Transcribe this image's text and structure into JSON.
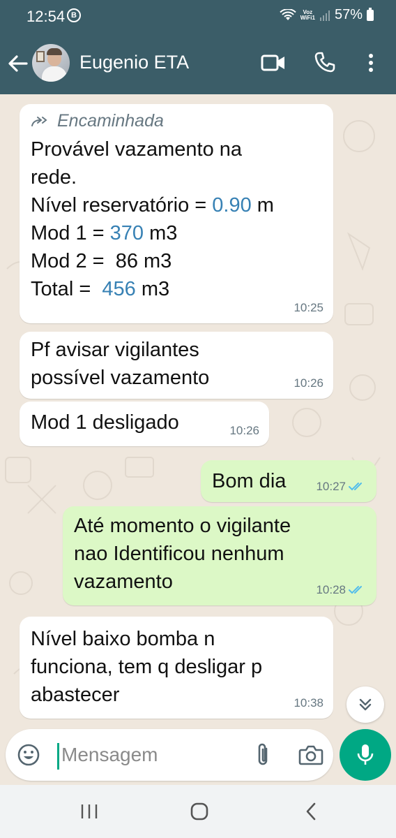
{
  "status": {
    "time": "12:54",
    "notification_badge": "B",
    "network_label_top": "Voz",
    "network_label_bottom": "WiFi1",
    "battery": "57%"
  },
  "header": {
    "contact_name": "Eugenio ETA"
  },
  "messages": [
    {
      "dir": "in",
      "forwarded_label": "Encaminhada",
      "lines": {
        "l1": "Provável vazamento na",
        "l2": "rede.",
        "l3_pre": "Nível reservatório = ",
        "l3_num": "0.90",
        "l3_post": " m",
        "l4_pre": "Mod 1 = ",
        "l4_num": "370",
        "l4_post": " m3",
        "l5": "Mod 2 =  86 m3",
        "l6_pre": "Total =  ",
        "l6_num": "456",
        "l6_post": " m3"
      },
      "time": "10:25"
    },
    {
      "dir": "in",
      "text": "Pf avisar vigilantes\npossível vazamento",
      "time": "10:26"
    },
    {
      "dir": "in",
      "text": "Mod 1 desligado",
      "time": "10:26"
    },
    {
      "dir": "out",
      "text": "Bom dia",
      "time": "10:27",
      "status": "read"
    },
    {
      "dir": "out",
      "text": "Até momento o vigilante\nnao Identificou nenhum\nvazamento",
      "time": "10:28",
      "status": "read"
    },
    {
      "dir": "in",
      "text": "Nível baixo bomba n\nfunciona, tem q desligar p\nabastecer",
      "time": "10:38"
    }
  ],
  "composer": {
    "placeholder": "Mensagem"
  },
  "colors": {
    "header_bg": "#3b5d68",
    "chat_bg": "#efe7dd",
    "incoming_bubble": "#ffffff",
    "outgoing_bubble": "#dcf8c6",
    "accent": "#00a884",
    "number_highlight": "#3781b4",
    "read_tick": "#53bdeb"
  },
  "icons": [
    "back-arrow-icon",
    "video-call-icon",
    "phone-icon",
    "more-vert-icon",
    "forward-icon",
    "double-check-icon",
    "chevron-double-down-icon",
    "emoji-icon",
    "attach-icon",
    "camera-icon",
    "mic-icon",
    "recents-icon",
    "home-icon",
    "back-icon"
  ]
}
